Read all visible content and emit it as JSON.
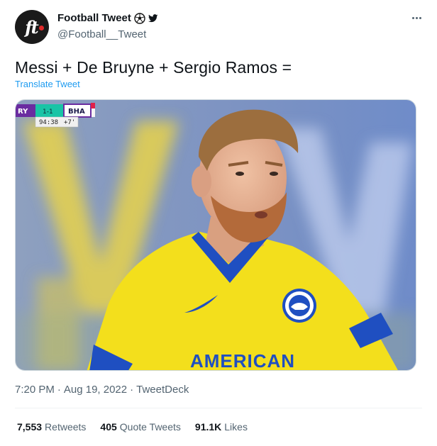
{
  "account": {
    "display_name": "Football Tweet",
    "handle": "@Football__Tweet",
    "avatar_text": "ft"
  },
  "tweet": {
    "text": "Messi + De Bruyne + Sergio Ramos =",
    "translate_label": "Translate Tweet"
  },
  "scoreboard": {
    "home": "RY",
    "score": "1-1",
    "away": "BHA",
    "clock": "94:38",
    "added_time": "+7'"
  },
  "jersey": {
    "sponsor": "AMERICAN"
  },
  "meta": {
    "time": "7:20 PM",
    "separator": "·",
    "date": "Aug 19, 2022",
    "source": "TweetDeck"
  },
  "stats": {
    "retweets_count": "7,553",
    "retweets_label": "Retweets",
    "quotes_count": "405",
    "quotes_label": "Quote Tweets",
    "likes_count": "91.1K",
    "likes_label": "Likes"
  },
  "colors": {
    "link": "#1d9bf0",
    "secondary_text": "#536471",
    "jersey_yellow": "#f4e21e",
    "jersey_blue": "#1f4fc1"
  }
}
